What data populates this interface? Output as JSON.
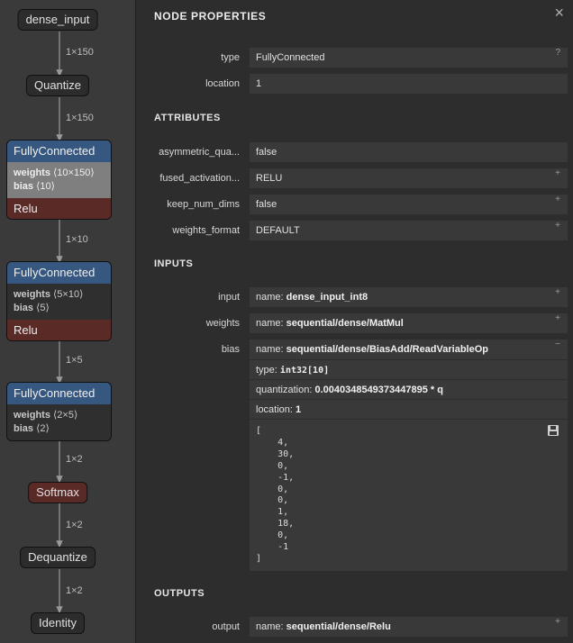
{
  "graph": {
    "input_node": "dense_input",
    "quantize_node": "Quantize",
    "edge_labels": [
      "1×150",
      "1×150",
      "1×10",
      "1×5",
      "1×2",
      "1×2",
      "1×2"
    ],
    "fc_nodes": [
      {
        "title": "FullyConnected",
        "weights_label": "weights",
        "weights_shape": "⟨10×150⟩",
        "bias_label": "bias",
        "bias_shape": "⟨10⟩",
        "activation": "Relu"
      },
      {
        "title": "FullyConnected",
        "weights_label": "weights",
        "weights_shape": "⟨5×10⟩",
        "bias_label": "bias",
        "bias_shape": "⟨5⟩",
        "activation": "Relu"
      },
      {
        "title": "FullyConnected",
        "weights_label": "weights",
        "weights_shape": "⟨2×5⟩",
        "bias_label": "bias",
        "bias_shape": "⟨2⟩"
      }
    ],
    "softmax_node": "Softmax",
    "dequantize_node": "Dequantize",
    "identity_node": "Identity"
  },
  "props": {
    "title": "NODE PROPERTIES",
    "close_icon": "×",
    "expand_icon": "+",
    "collapse_icon": "−",
    "help_icon": "?",
    "type_label": "type",
    "type_value": "FullyConnected",
    "location_label": "location",
    "location_value": "1",
    "attributes_title": "ATTRIBUTES",
    "attributes": [
      {
        "label": "asymmetric_qua...",
        "value": "false"
      },
      {
        "label": "fused_activation...",
        "value": "RELU"
      },
      {
        "label": "keep_num_dims",
        "value": "false"
      },
      {
        "label": "weights_format",
        "value": "DEFAULT"
      }
    ],
    "inputs_title": "INPUTS",
    "name_prefix": "name:",
    "inputs": [
      {
        "label": "input",
        "name": "dense_input_int8"
      },
      {
        "label": "weights",
        "name": "sequential/dense/MatMul"
      }
    ],
    "bias": {
      "label": "bias",
      "name": "sequential/dense/BiasAdd/ReadVariableOp",
      "type_prefix": "type:",
      "type_value": "int32[10]",
      "quant_prefix": "quantization:",
      "quant_value": "0.0040348549373447895 * q",
      "location_prefix": "location:",
      "location_value": "1",
      "tensor_text": "[\n    4,\n    30,\n    0,\n    -1,\n    0,\n    0,\n    1,\n    18,\n    0,\n    -1\n]"
    },
    "outputs_title": "OUTPUTS",
    "output": {
      "label": "output",
      "name": "sequential/dense/Relu"
    }
  }
}
